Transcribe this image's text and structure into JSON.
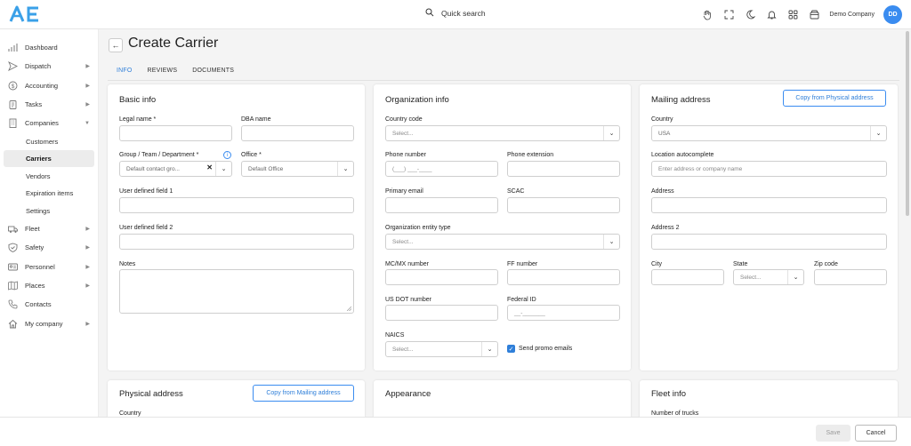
{
  "topbar": {
    "logo_text": "AE",
    "search_label": "Quick search",
    "company_name": "Demo Company",
    "avatar_initials": "DD",
    "icons": [
      "hand-icon",
      "fullscreen-icon",
      "moon-icon",
      "bell-icon",
      "grid-icon",
      "wallet-icon"
    ]
  },
  "sidebar": {
    "items": [
      {
        "label": "Dashboard",
        "icon": "chart-icon",
        "chevron": false
      },
      {
        "label": "Dispatch",
        "icon": "send-icon",
        "chevron": true
      },
      {
        "label": "Accounting",
        "icon": "dollar-icon",
        "chevron": true
      },
      {
        "label": "Tasks",
        "icon": "clipboard-icon",
        "chevron": true
      },
      {
        "label": "Companies",
        "icon": "building-icon",
        "chevron": true,
        "expanded": true
      }
    ],
    "sub_items": [
      "Customers",
      "Carriers",
      "Vendors",
      "Expiration items",
      "Settings"
    ],
    "active_sub": "Carriers",
    "items_after": [
      {
        "label": "Fleet",
        "icon": "truck-icon",
        "chevron": true
      },
      {
        "label": "Safety",
        "icon": "shield-icon",
        "chevron": true
      },
      {
        "label": "Personnel",
        "icon": "id-card-icon",
        "chevron": true
      },
      {
        "label": "Places",
        "icon": "map-icon",
        "chevron": true
      },
      {
        "label": "Contacts",
        "icon": "phone-icon",
        "chevron": false
      },
      {
        "label": "My company",
        "icon": "home-icon",
        "chevron": true
      }
    ]
  },
  "page": {
    "title": "Create Carrier",
    "tabs": [
      "INFO",
      "REVIEWS",
      "DOCUMENTS"
    ],
    "active_tab": "INFO"
  },
  "basic_info": {
    "title": "Basic info",
    "legal_name_label": "Legal name *",
    "dba_name_label": "DBA name",
    "group_label": "Group / Team / Department *",
    "group_value": "Default contact gro...",
    "office_label": "Office *",
    "office_value": "Default Office",
    "udf1_label": "User defined field 1",
    "udf2_label": "User defined field 2",
    "notes_label": "Notes"
  },
  "org_info": {
    "title": "Organization info",
    "country_code_label": "Country code",
    "country_code_placeholder": "Select...",
    "phone_label": "Phone number",
    "phone_mask": "(___) ___-____",
    "phone_ext_label": "Phone extension",
    "email_label": "Primary email",
    "scac_label": "SCAC",
    "entity_type_label": "Organization entity type",
    "entity_type_placeholder": "Select...",
    "mcmx_label": "MC/MX number",
    "ff_label": "FF number",
    "usdot_label": "US DOT number",
    "federal_id_label": "Federal ID",
    "federal_id_mask": "__-_______",
    "naics_label": "NAICS",
    "naics_placeholder": "Select...",
    "promo_label": "Send promo emails"
  },
  "mailing": {
    "title": "Mailing address",
    "copy_button": "Copy from Physical address",
    "country_label": "Country",
    "country_value": "USA",
    "autocomplete_label": "Location autocomplete",
    "autocomplete_placeholder": "Enter address or company name",
    "address_label": "Address",
    "address2_label": "Address 2",
    "city_label": "City",
    "state_label": "State",
    "state_placeholder": "Select...",
    "zip_label": "Zip code"
  },
  "physical": {
    "title": "Physical address",
    "copy_button": "Copy from Mailing address",
    "country_label": "Country"
  },
  "appearance": {
    "title": "Appearance"
  },
  "fleet": {
    "title": "Fleet info",
    "trucks_label": "Number of trucks"
  },
  "footer": {
    "save": "Save",
    "cancel": "Cancel"
  }
}
